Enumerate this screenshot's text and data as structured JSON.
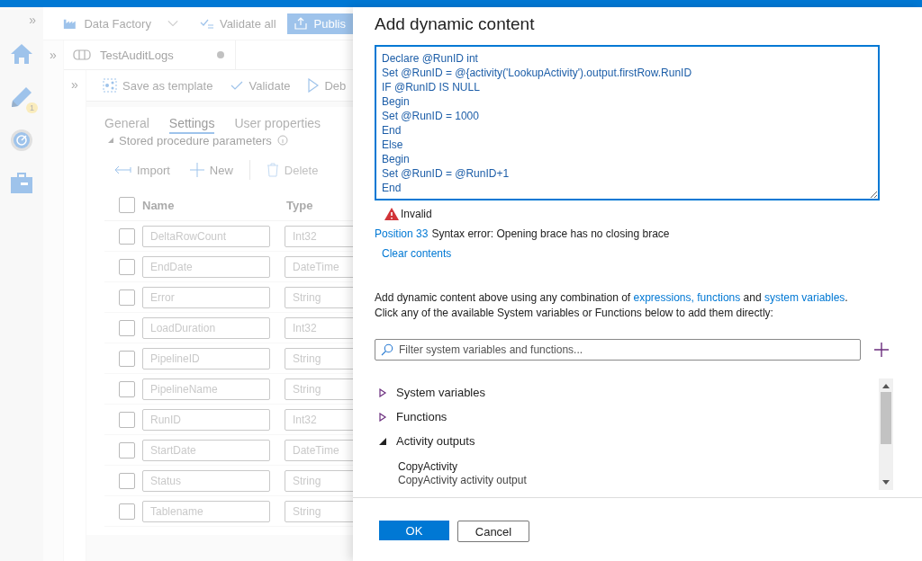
{
  "nav": {
    "expand": "»",
    "items": [
      {
        "kind": "home"
      },
      {
        "kind": "pencil",
        "badge": "1"
      },
      {
        "kind": "gauge"
      },
      {
        "kind": "toolbox"
      }
    ]
  },
  "factory_bar": {
    "factory": "Data Factory",
    "validate_all": "Validate all",
    "publish": "Publis"
  },
  "side_expand": [
    "»",
    "»"
  ],
  "pipeline_tab": {
    "title": "TestAuditLogs",
    "unsaved": true
  },
  "pipeline_toolbar": [
    {
      "kind": "template",
      "label": "Save as template"
    },
    {
      "kind": "validate",
      "label": "Validate"
    },
    {
      "kind": "debug",
      "label": "Deb"
    }
  ],
  "tabs": [
    {
      "label": "General",
      "selected": false
    },
    {
      "label": "Settings",
      "selected": true
    },
    {
      "label": "User properties",
      "selected": false
    }
  ],
  "section": {
    "title": "Stored procedure parameters",
    "expanded": true
  },
  "actions": [
    {
      "kind": "import",
      "label": "Import",
      "disabled": false
    },
    {
      "kind": "new",
      "label": "New",
      "disabled": false
    },
    {
      "kind": "delete",
      "label": "Delete",
      "disabled": true
    }
  ],
  "table": {
    "columns": [
      "Name",
      "Type"
    ],
    "all_checked": false,
    "rows": [
      {
        "name": "DeltaRowCount",
        "type": "Int32",
        "checked": false
      },
      {
        "name": "EndDate",
        "type": "DateTime",
        "checked": false
      },
      {
        "name": "Error",
        "type": "String",
        "checked": false
      },
      {
        "name": "LoadDuration",
        "type": "Int32",
        "checked": false
      },
      {
        "name": "PipelineID",
        "type": "String",
        "checked": false
      },
      {
        "name": "PipelineName",
        "type": "String",
        "checked": false
      },
      {
        "name": "RunID",
        "type": "Int32",
        "checked": false
      },
      {
        "name": "StartDate",
        "type": "DateTime",
        "checked": false
      },
      {
        "name": "Status",
        "type": "String",
        "checked": false
      },
      {
        "name": "Tablename",
        "type": "String",
        "checked": false
      }
    ]
  },
  "dialog": {
    "title": "Add dynamic content",
    "expression": [
      "Declare @RunID int",
      "Set @RunID = @{activity('LookupActivity').output.firstRow.RunID",
      "IF @RunID IS NULL",
      "Begin",
      "Set @RunID = 1000",
      "End",
      "Else",
      "Begin",
      "Set @RunID = @RunID+1",
      "End"
    ],
    "status": "Invalid",
    "error_position": "Position 33",
    "error_text": "Syntax error: Opening brace has no closing brace",
    "clear": "Clear contents",
    "help": [
      {
        "kind": "text",
        "text": "Add dynamic content above using any combination of "
      },
      {
        "kind": "link",
        "text": "expressions, functions"
      },
      {
        "kind": "text",
        "text": " and "
      },
      {
        "kind": "link",
        "text": "system variables"
      },
      {
        "kind": "text",
        "text": "."
      },
      {
        "kind": "break",
        "text": "Click any of the available System variables or Functions below to add them directly:"
      }
    ],
    "filter_placeholder": "Filter system variables and functions...",
    "tree": [
      {
        "label": "System variables",
        "expanded": false
      },
      {
        "label": "Functions",
        "expanded": false
      },
      {
        "label": "Activity outputs",
        "expanded": true,
        "children": [
          {
            "label": "CopyActivity",
            "description": "CopyActivity activity output"
          }
        ]
      }
    ],
    "ok": "OK",
    "cancel": "Cancel"
  }
}
